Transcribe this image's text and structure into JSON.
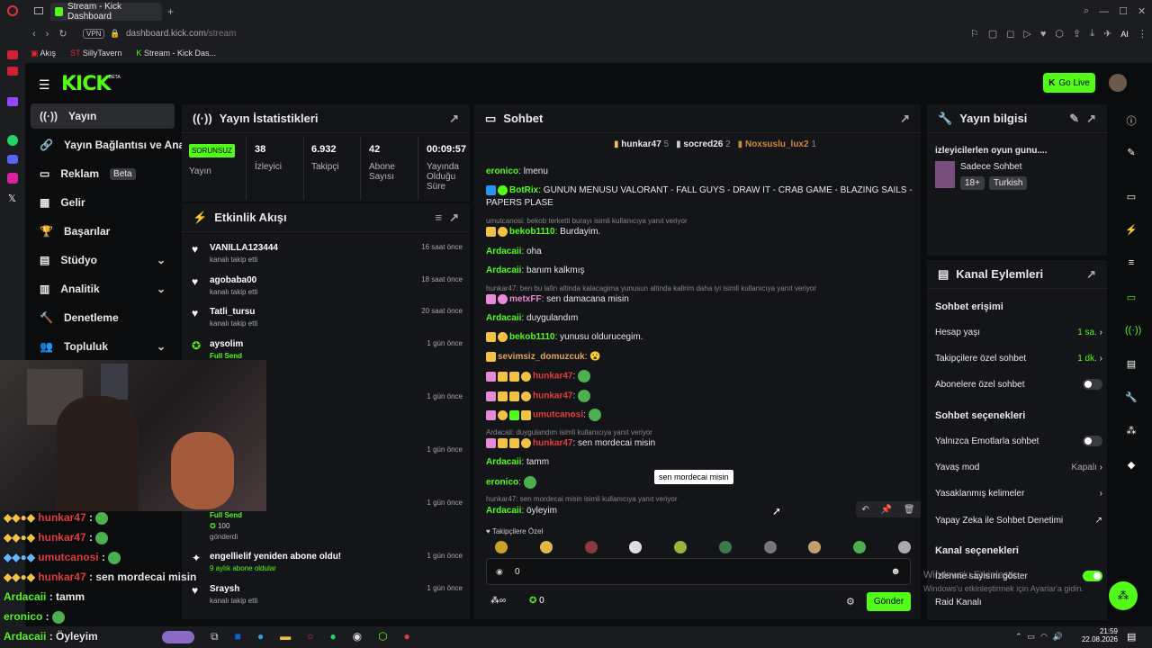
{
  "browser": {
    "tab_title": "Stream - Kick Dashboard",
    "url_domain": "dashboard.kick.com",
    "url_path": "/stream",
    "vpn": "VPN",
    "ai": "AI",
    "bookmarks": [
      "Akış",
      "SillyTavern",
      "Stream - Kick Das..."
    ]
  },
  "header": {
    "logo": "KICK",
    "beta": "BETA",
    "go_live": "Go Live"
  },
  "nav": [
    {
      "label": "Yayın"
    },
    {
      "label": "Yayın Bağlantısı ve Anahtar"
    },
    {
      "label": "Reklam",
      "badge": "Beta"
    },
    {
      "label": "Gelir"
    },
    {
      "label": "Başarılar"
    },
    {
      "label": "Stüdyo"
    },
    {
      "label": "Analitik"
    },
    {
      "label": "Denetleme"
    },
    {
      "label": "Topluluk"
    }
  ],
  "stats": {
    "title": "Yayın İstatistikleri",
    "status": "SORUNSUZ",
    "status_label": "Yayın",
    "cols": [
      {
        "value": "38",
        "label": "İzleyici"
      },
      {
        "value": "6.932",
        "label": "Takipçi"
      },
      {
        "value": "42",
        "label": "Abone Sayısı"
      },
      {
        "value": "00:09:57",
        "label": "Yayında Olduğu Süre"
      }
    ]
  },
  "activity": {
    "title": "Etkinlik Akışı",
    "items": [
      {
        "name": "VANILLA123444",
        "sub": "kanalı takip etti",
        "time": "16 saat önce"
      },
      {
        "name": "agobaba00",
        "sub": "kanalı takip etti",
        "time": "18 saat önce"
      },
      {
        "name": "Tatli_tursu",
        "sub": "kanalı takip etti",
        "time": "20 saat önce"
      },
      {
        "name": "aysolim",
        "sub": "Full Send",
        "time": "1 gün önce"
      },
      {
        "time": "1 gün önce"
      },
      {
        "time": "1 gün önce"
      },
      {
        "sub": "Full Send",
        "amount": "100",
        "amount_label": "gönderdi",
        "time": "1 gün önce"
      },
      {
        "name": "engellielif yeniden abone oldu!",
        "sub": "9 aylık abone oldular",
        "time": "1 gün önce"
      },
      {
        "name": "Sraysh",
        "sub": "kanalı takip etti",
        "time": "1 gün önce"
      }
    ]
  },
  "chat": {
    "title": "Sohbet",
    "top": [
      {
        "name": "hunkar47",
        "n": "5"
      },
      {
        "name": "socred26",
        "n": "2"
      },
      {
        "name": "Noxsuslu_lux2",
        "n": "1"
      }
    ],
    "messages": [
      {
        "user": "eronico",
        "text": "lmenu"
      },
      {
        "user": "BotRix",
        "text": "GUNUN MENUSU VALORANT - FALL GUYS - DRAW IT - CRAB GAME - BLAZING SAILS - PAPERS PLASE"
      },
      {
        "reply": "umutcanosi: bekob terketti burayı isimli kullanıcıya yanıt veriyor"
      },
      {
        "user": "bekob1110",
        "text": "Burdayim."
      },
      {
        "user": "Ardacaii",
        "text": "oha"
      },
      {
        "user": "Ardacaii",
        "text": "banım kalkmış"
      },
      {
        "reply": "hunkar47: ben bu lafin altinda kalacagima yunusun altinda kalirim daha iyi isimli kullanıcıya yanıt veriyor"
      },
      {
        "user": "metxFF",
        "text": "sen damacana misin"
      },
      {
        "user": "Ardacaii",
        "text": "duygulandım"
      },
      {
        "user": "bekob1110",
        "text": "yunusu oldurucegim."
      },
      {
        "user": "sevimsiz_domuzcuk",
        "text": "😮"
      },
      {
        "user": "hunkar47",
        "text": ""
      },
      {
        "user": "hunkar47",
        "text": ""
      },
      {
        "user": "umutcanosi",
        "text": ""
      },
      {
        "reply": "Ardacaii: duygulandım isimli kullanıcıya yanıt veriyor"
      },
      {
        "user": "hunkar47",
        "text": "sen mordecai misin"
      },
      {
        "user": "Ardacaii",
        "text": "tamm"
      },
      {
        "user": "eronico",
        "text": ""
      },
      {
        "reply": "hunkar47: sen mordecai misin isimli kullanıcıya yanıt veriyor"
      },
      {
        "user": "Ardacaii",
        "text": "öyleyim"
      }
    ],
    "tooltip": "sen mordecai misin",
    "emote_label": "Takipçilere Özel",
    "input_value": "0",
    "points": "0",
    "send": "Gönder"
  },
  "info": {
    "title": "Yayın bilgisi",
    "stream_title": "izleyicilerlen oyun gunu....",
    "category": "Sadece Sohbet",
    "tags": [
      "18+",
      "Turkish"
    ]
  },
  "actions": {
    "title": "Kanal Eylemleri",
    "chat_access": "Sohbet erişimi",
    "rows": [
      {
        "label": "Hesap yaşı",
        "value": "1 sa."
      },
      {
        "label": "Takipçilere özel sohbet",
        "value": "1 dk."
      },
      {
        "label": "Abonelere özel sohbet",
        "toggle": false
      }
    ],
    "options_title": "Sohbet seçenekleri",
    "options": [
      {
        "label": "Yalnızca Emotlarla sohbet",
        "toggle": false
      },
      {
        "label": "Yavaş mod",
        "value": "Kapalı"
      },
      {
        "label": "Yasaklanmış kelimeler"
      },
      {
        "label": "Yapay Zeka ile Sohbet Denetimi"
      }
    ],
    "channel_title": "Kanal seçenekleri",
    "channel": [
      {
        "label": "İzlenme sayısını göster",
        "toggle": true
      },
      {
        "label": "Raid Kanalı"
      }
    ]
  },
  "windows_watermark": {
    "line1": "Windows'u Etkinleştir",
    "line2": "Windows'u etkinleştirmek için Ayarlar'a gidin."
  },
  "overlay": {
    "chat": [
      {
        "user": "hunkar47",
        "text": ""
      },
      {
        "user": "hunkar47",
        "text": ""
      },
      {
        "user": "umutcanosi",
        "text": ""
      },
      {
        "user": "hunkar47",
        "text": "sen mordecai misin"
      },
      {
        "user": "Ardacaii",
        "text": "tamm"
      },
      {
        "user": "eronico",
        "text": ""
      },
      {
        "user": "Ardacaii",
        "text": "Öyleyim"
      }
    ]
  },
  "taskbar": {
    "time": "21:59",
    "date": "22.08.2026"
  },
  "colors": {
    "accent": "#53fc18",
    "bg": "#0b0c0e",
    "panel": "#141518"
  }
}
